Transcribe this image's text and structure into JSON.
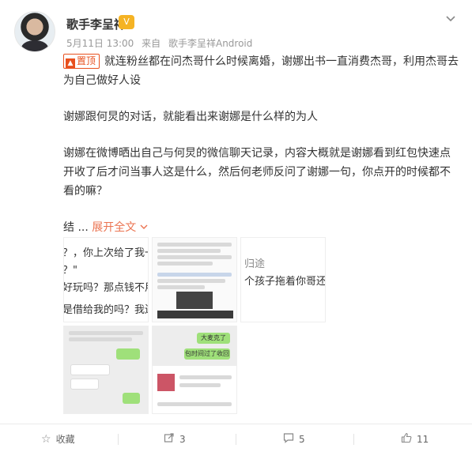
{
  "author": {
    "name": "歌手李呈祥",
    "badge_icon": "vip-badge-icon"
  },
  "meta": {
    "date": "5月11日 13:00",
    "source_prefix": "来自",
    "source": "歌手李呈祥Android"
  },
  "post": {
    "pinned_label": "置顶",
    "para1": "就连粉丝都在问杰哥什么时候离婚，谢娜出书一直消费杰哥，利用杰哥去为自己做好人设",
    "para2": "谢娜跟何炅的对话，就能看出来谢娜是什么样的为人",
    "para3": "谢娜在微博晒出自己与何炅的微信聊天记录，内容大概就是谢娜看到红包快速点开收了后才问当事人这是什么，然后何老师反问了谢娜一句，你点开的时候都不看的嘛？",
    "para4_prefix": "结 ...",
    "expand_label": "展开全文",
    "expand_icon": "chevron-down-icon"
  },
  "images": {
    "thumb1_lines": [
      "？，你上次给了我一点钱",
      "？\"",
      "好玩吗？那点钱不用还",
      "是借给我的吗？我还以"
    ],
    "thumb3_lines": [
      "归途",
      "个孩子拖着你哥还"
    ],
    "thumb5_bubble1": "大麦克了",
    "thumb5_bubble2": "包时间过了收回"
  },
  "footer": {
    "favorite_label": "收藏",
    "favorite_icon": "star-icon",
    "repost_count": "3",
    "repost_icon": "repost-icon",
    "comment_count": "5",
    "comment_icon": "comment-icon",
    "like_count": "11",
    "like_icon": "thumbs-up-icon"
  }
}
